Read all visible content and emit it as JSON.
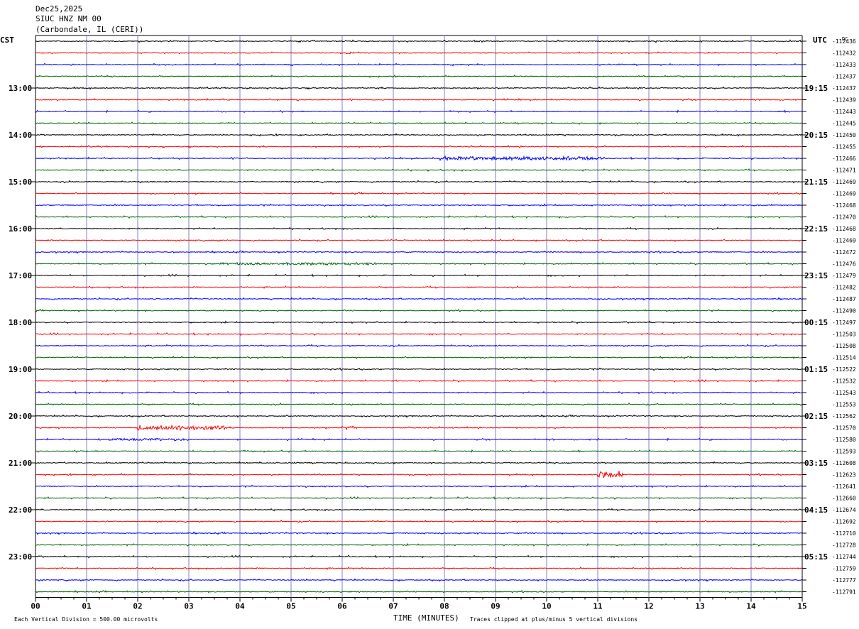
{
  "header": {
    "date": "Dec25,2025",
    "station": "SIUC HNZ NM 00",
    "location": "(Carbondale, IL (CERI))"
  },
  "left_tz": "CST",
  "right_tz": "UTC",
  "dc_label": "DC",
  "footer": {
    "scale_note": "Each Vertical Division =  500.00 microvolts",
    "xlabel": "TIME (MINUTES)",
    "clip_note": "Traces clipped at plus/minus 5 vertical divisions"
  },
  "colors": {
    "black": "#000000",
    "red": "#ff0000",
    "blue": "#0000ff",
    "green": "#006400",
    "grid": "#8080c0"
  },
  "chart_data": {
    "type": "line",
    "title": "SIUC HNZ NM 00",
    "xlabel": "TIME (MINUTES)",
    "xlim": [
      0,
      15
    ],
    "x_ticks": [
      "00",
      "01",
      "02",
      "03",
      "04",
      "05",
      "06",
      "07",
      "08",
      "09",
      "10",
      "11",
      "12",
      "13",
      "14",
      "15"
    ],
    "trace_color_cycle": [
      "black",
      "red",
      "blue",
      "green"
    ],
    "left_hour_labels": [
      "13:00",
      "14:00",
      "15:00",
      "16:00",
      "17:00",
      "18:00",
      "19:00",
      "20:00",
      "21:00",
      "22:00",
      "23:00"
    ],
    "right_hour_labels": [
      "19:15",
      "20:15",
      "21:15",
      "22:15",
      "23:15",
      "00:15",
      "01:15",
      "02:15",
      "03:15",
      "04:15",
      "05:15"
    ],
    "dc_offsets": [
      "-112436",
      "-112432",
      "-112433",
      "-112437",
      "-112437",
      "-112439",
      "-112443",
      "-112445",
      "-112450",
      "-112455",
      "-112466",
      "-112471",
      "-112469",
      "-112469",
      "-112468",
      "-112470",
      "-112468",
      "-112469",
      "-112472",
      "-112476",
      "-112479",
      "-112482",
      "-112487",
      "-112490",
      "-112497",
      "-112503",
      "-112508",
      "-112514",
      "-112522",
      "-112532",
      "-112543",
      "-112553",
      "-112562",
      "-112570",
      "-112580",
      "-112593",
      "-112608",
      "-112623",
      "-112641",
      "-112660",
      "-112674",
      "-112692",
      "-112710",
      "-112728",
      "-112744",
      "-112759",
      "-112777",
      "-112791"
    ],
    "events": [
      {
        "trace": 10,
        "x_start": 7.9,
        "x_end": 11.1,
        "amp": 3
      },
      {
        "trace": 19,
        "x_start": 3.6,
        "x_end": 6.8,
        "amp": 2
      },
      {
        "trace": 33,
        "x_start": 2.0,
        "x_end": 3.7,
        "amp": 4
      },
      {
        "trace": 33,
        "x_start": 6.0,
        "x_end": 6.3,
        "amp": 3
      },
      {
        "trace": 34,
        "x_start": 1.2,
        "x_end": 3.0,
        "amp": 2
      },
      {
        "trace": 37,
        "x_start": 11.0,
        "x_end": 11.5,
        "amp": 6
      }
    ]
  }
}
